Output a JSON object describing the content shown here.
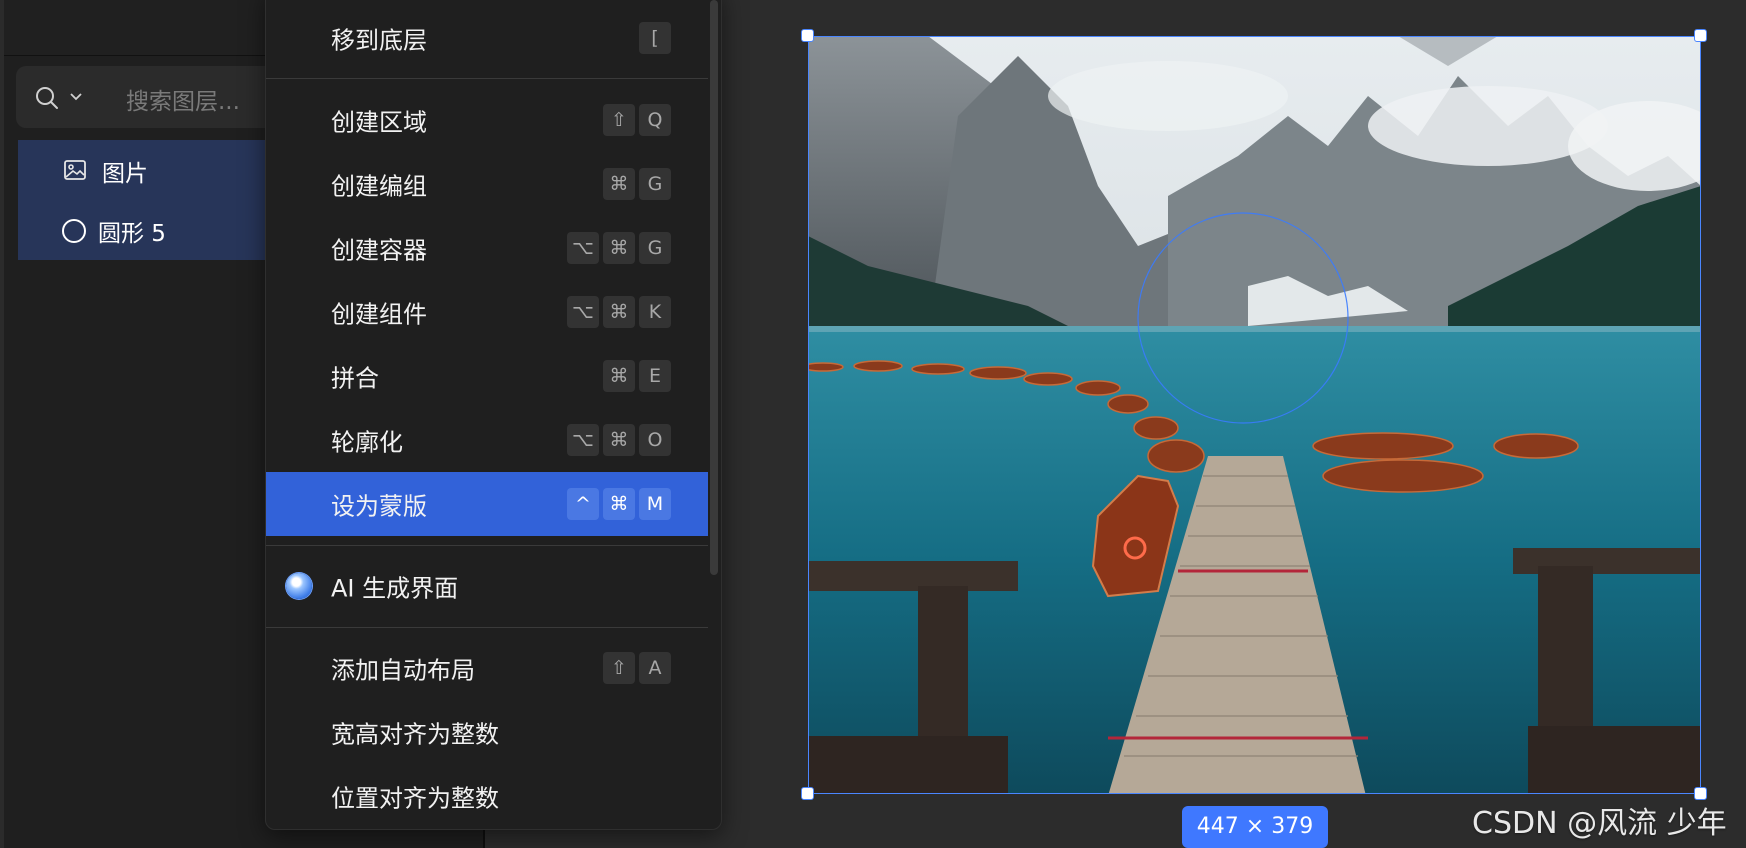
{
  "layers_panel": {
    "search_placeholder": "搜索图层...",
    "layers": [
      {
        "label": "图片",
        "icon": "image-icon"
      },
      {
        "label": "圆形 5",
        "icon": "circle-icon"
      }
    ]
  },
  "context_menu": {
    "items": [
      {
        "label": "移到底层",
        "keys": [
          "["
        ]
      },
      {
        "label": "创建区域",
        "keys": [
          "⇧",
          "Q"
        ]
      },
      {
        "label": "创建编组",
        "keys": [
          "⌘",
          "G"
        ]
      },
      {
        "label": "创建容器",
        "keys": [
          "⌥",
          "⌘",
          "G"
        ]
      },
      {
        "label": "创建组件",
        "keys": [
          "⌥",
          "⌘",
          "K"
        ]
      },
      {
        "label": "拼合",
        "keys": [
          "⌘",
          "E"
        ]
      },
      {
        "label": "轮廓化",
        "keys": [
          "⌥",
          "⌘",
          "O"
        ]
      },
      {
        "label": "设为蒙版",
        "keys": [
          "^",
          "⌘",
          "M"
        ],
        "highlighted": true
      },
      {
        "label": "AI 生成界面",
        "icon": "ai-sparkle-icon"
      },
      {
        "label": "添加自动布局",
        "keys": [
          "⇧",
          "A"
        ]
      },
      {
        "label": "宽高对齐为整数"
      },
      {
        "label": "位置对齐为整数"
      }
    ]
  },
  "canvas": {
    "selection_size": "447 × 379",
    "image_subject": "mountain lake with wooden pier and rowing boats",
    "selection_color": "#4a86ff",
    "highlight_color": "#3262d9"
  },
  "watermark": "CSDN @风流 少年"
}
